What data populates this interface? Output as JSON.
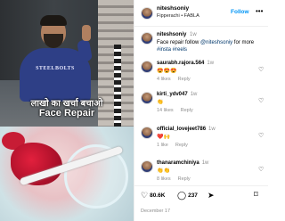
{
  "post": {
    "overlay_line1": "लाखो का खर्चा बचाओ",
    "overlay_line2": "Face Repair"
  },
  "header": {
    "username": "niteshsoniy",
    "subtitle": "Fipperachi • FABLA",
    "follow_label": "Follow",
    "more_icon": "•••"
  },
  "caption": {
    "username": "niteshsoniy",
    "time": "1w",
    "text": "Face repair follow ",
    "mention": "@niteshsoniy",
    "text_after": " for more",
    "hashtags": "#insta #reels"
  },
  "comments": [
    {
      "username": "saurabh.rajora.564",
      "time": "1w",
      "text": "😍😍😍",
      "likes": "4 likes",
      "reply": "Reply"
    },
    {
      "username": "kirti_ydv047",
      "time": "1w",
      "text": "👏",
      "likes": "14 likes",
      "reply": "Reply"
    },
    {
      "username": "official_lovejeet786",
      "time": "1w",
      "text": "❤️🙌",
      "likes": "1 like",
      "reply": "Reply"
    },
    {
      "username": "thanaramchiniya",
      "time": "1w",
      "text": "👏👏",
      "likes": "8 likes",
      "reply": "Reply"
    }
  ],
  "actions": {
    "likes": "80.6K",
    "comments": "237",
    "date": "December 17"
  },
  "colors": {
    "link": "#00376b",
    "follow": "#0095f6",
    "meta": "#8e8e8e"
  },
  "icons": [
    "heart-icon",
    "comment-icon",
    "share-icon",
    "bookmark-icon",
    "more-icon"
  ]
}
